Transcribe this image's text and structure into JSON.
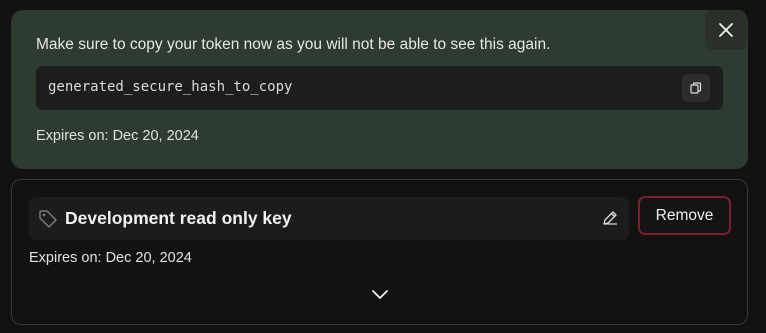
{
  "token_notice": {
    "message": "Make sure to copy your token now as you will not be able to see this again.",
    "token": "generated_secure_hash_to_copy",
    "expires": "Expires on: Dec 20, 2024",
    "close_icon": "close-icon",
    "copy_icon": "copy-icon"
  },
  "key": {
    "name": "Development read only key",
    "expires": "Expires on: Dec 20, 2024",
    "remove_label": "Remove",
    "tag_icon": "tag-icon",
    "edit_icon": "pencil-icon",
    "expand_icon": "chevron-down-icon"
  },
  "colors": {
    "notice_bg": "#2d3b31",
    "remove_border": "#7a1f2e"
  }
}
